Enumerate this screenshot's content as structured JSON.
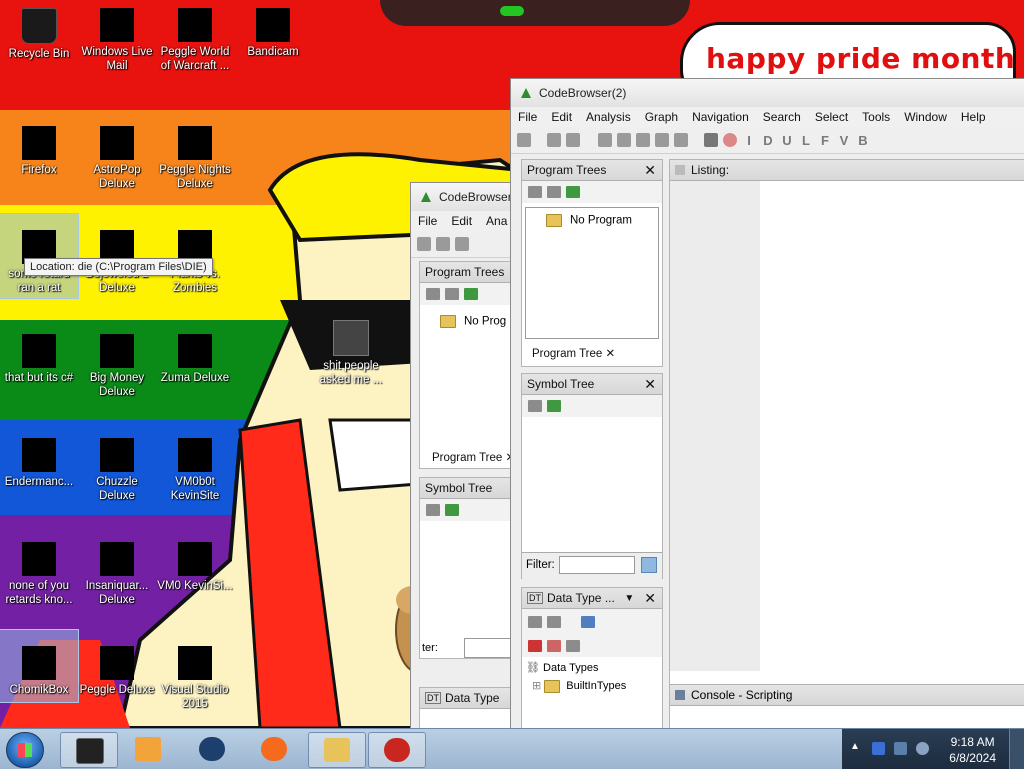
{
  "wallpaper": {
    "speech_bubble": "happy pride month"
  },
  "desktop_icons": [
    {
      "label": "Recycle Bin"
    },
    {
      "label": "Windows Live Mail"
    },
    {
      "label": "Peggle World of Warcraft ..."
    },
    {
      "label": "Bandicam"
    },
    {
      "label": "Firefox"
    },
    {
      "label": "AstroPop Deluxe"
    },
    {
      "label": "Peggle Nights Deluxe"
    },
    {
      "label": "some retard ran a rat"
    },
    {
      "label": "Bejeweled 2 Deluxe"
    },
    {
      "label": "Plants vs. Zombies"
    },
    {
      "label": "that but its c#"
    },
    {
      "label": "Big Money Deluxe"
    },
    {
      "label": "Zuma Deluxe"
    },
    {
      "label": "shit people asked me ..."
    },
    {
      "label": "Endermanc..."
    },
    {
      "label": "Chuzzle Deluxe"
    },
    {
      "label": "VM0b0t KevinSite"
    },
    {
      "label": "none of you retards kno..."
    },
    {
      "label": "Insaniquar... Deluxe"
    },
    {
      "label": "VM0 KevinSi..."
    },
    {
      "label": "ChomikBox"
    },
    {
      "label": "Peggle Deluxe"
    },
    {
      "label": "Visual Studio 2015"
    }
  ],
  "tooltip": "Location: die (C:\\Program Files\\DIE)",
  "back_window": {
    "title": "CodeBrowser",
    "menu": [
      "File",
      "Edit",
      "Ana"
    ],
    "program_trees_header": "Program Trees",
    "no_program": "No Prog",
    "program_tree_tab": "Program Tree",
    "symbol_tree_header": "Symbol Tree",
    "filter_label": "ter:",
    "data_type_header": "Data Type"
  },
  "front_window": {
    "title": "CodeBrowser(2)",
    "menu": [
      "File",
      "Edit",
      "Analysis",
      "Graph",
      "Navigation",
      "Search",
      "Select",
      "Tools",
      "Window",
      "Help"
    ],
    "toolbar_letters": [
      "I",
      "D",
      "U",
      "L",
      "F",
      "V",
      "B"
    ],
    "program_trees_header": "Program Trees",
    "no_program": "No Program",
    "program_tree_tab": "Program Tree",
    "symbol_tree_header": "Symbol Tree",
    "filter_label": "Filter:",
    "filter_value": "",
    "data_type_header": "Data Type ...",
    "data_types_root": "Data Types",
    "builtin_types": "BuiltInTypes",
    "listing_header": "Listing:",
    "console_header": "Console - Scripting"
  },
  "taskbar": {
    "time": "9:18 AM",
    "date": "6/8/2024"
  },
  "colors": {
    "red": "#e8120f",
    "orange": "#f7841a",
    "yellow": "#fff200",
    "green": "#0a8a17",
    "blue": "#1257d8",
    "purple": "#7320a4"
  }
}
